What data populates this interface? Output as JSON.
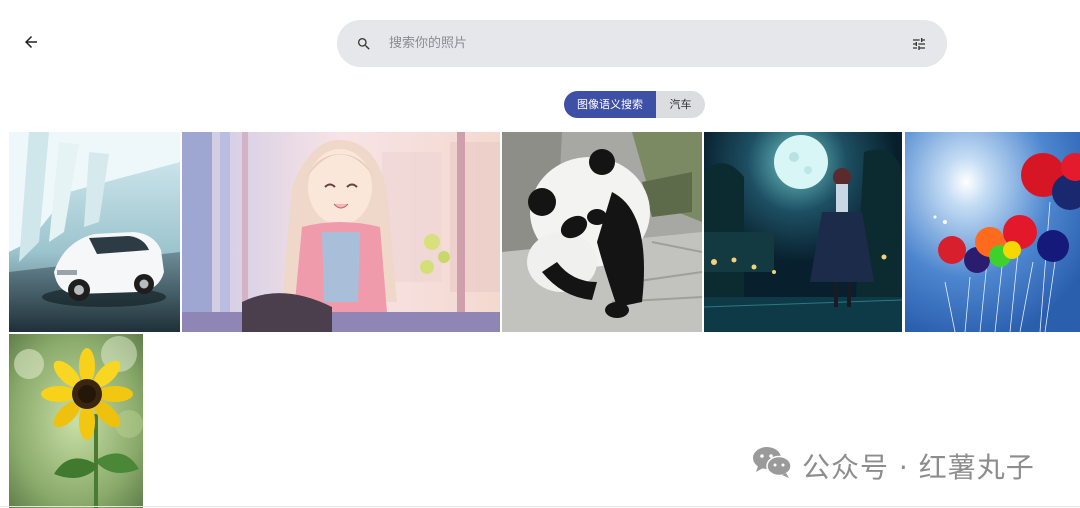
{
  "header": {
    "back_icon": "arrow-left-icon"
  },
  "search": {
    "placeholder": "搜索你的照片",
    "value": "",
    "search_icon": "search-icon",
    "filter_icon": "tune-icon"
  },
  "chips": [
    {
      "label": "图像语义搜索",
      "active": true
    },
    {
      "label": "汽车",
      "active": false
    }
  ],
  "photos": [
    {
      "subject": "white sedan car in white tunnel"
    },
    {
      "subject": "anime girl smiling sitting by window"
    },
    {
      "subject": "giant panda walking on stone"
    },
    {
      "subject": "anime girl under full moon at night"
    },
    {
      "subject": "colorful balloons in blue sky"
    },
    {
      "subject": "sunflower"
    }
  ],
  "watermark": {
    "text": "公众号 · 红薯丸子",
    "icon": "wechat-icon"
  },
  "colors": {
    "accent": "#3e4fa6",
    "search_bg": "#e6e7ea",
    "chip_inactive": "#dcdde0"
  }
}
